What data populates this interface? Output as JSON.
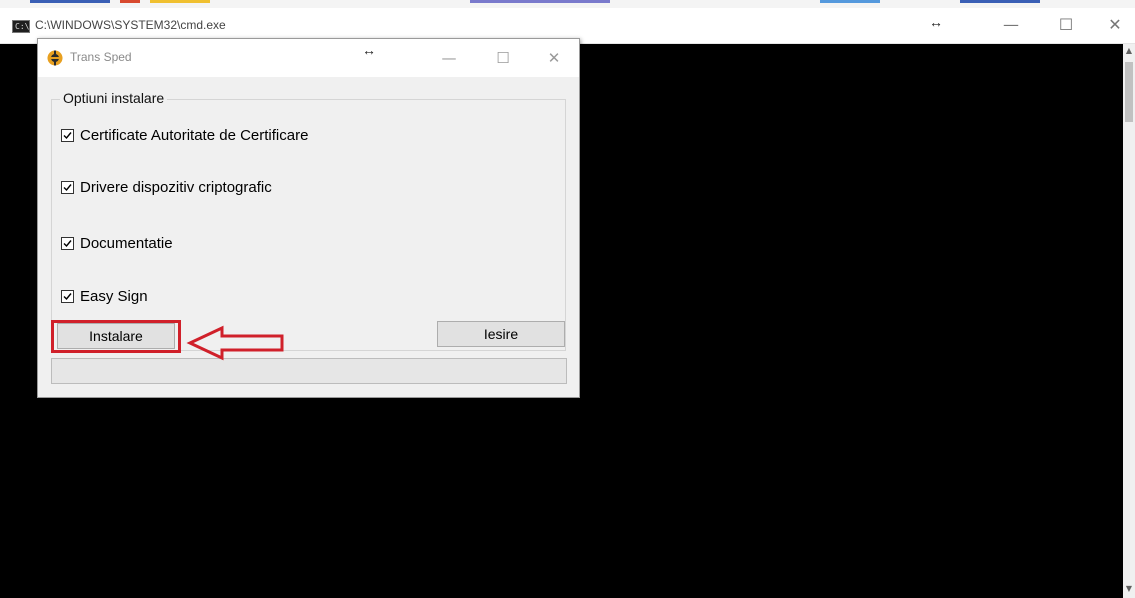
{
  "cmd_window": {
    "title": "C:\\WINDOWS\\SYSTEM32\\cmd.exe",
    "icon": "cmd-icon",
    "resize_icon": "↔",
    "minimize": "—",
    "maximize": "☐",
    "close": "✕"
  },
  "dialog": {
    "title": "Trans Sped",
    "icon": "transsped-logo-icon",
    "resize_icon": "↔",
    "minimize": "—",
    "maximize": "☐",
    "close": "✕",
    "group_title": "Optiuni instalare",
    "options": [
      {
        "label": "Certificate Autoritate de Certificare",
        "checked": true
      },
      {
        "label": "Drivere dispozitiv criptografic",
        "checked": true
      },
      {
        "label": "Documentatie",
        "checked": true
      },
      {
        "label": "Easy Sign",
        "checked": true
      }
    ],
    "install_button": "Instalare",
    "exit_button": "Iesire",
    "progress": 0
  },
  "annotation": {
    "color": "#d0202a",
    "arrow_icon": "left-arrow-annotation-icon"
  }
}
